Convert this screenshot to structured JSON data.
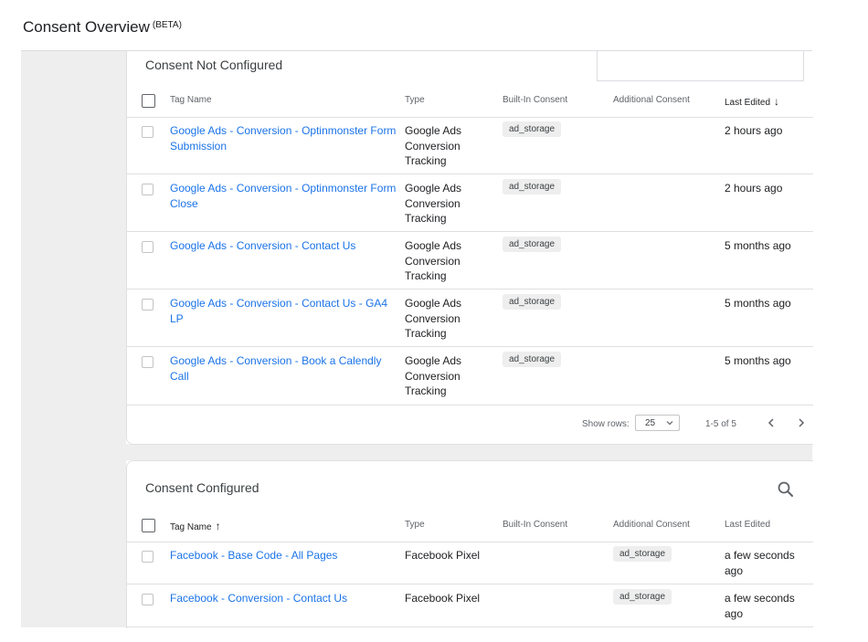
{
  "page": {
    "title": "Consent Overview",
    "title_badge": "(BETA)"
  },
  "columns": {
    "tag_name": "Tag Name",
    "type": "Type",
    "built_in": "Built-In Consent",
    "additional": "Additional Consent",
    "last_edited": "Last Edited"
  },
  "not_configured": {
    "title": "Consent Not Configured",
    "sort_column": "Last Edited",
    "sort_arrow": "↓",
    "rows": [
      {
        "name": "Google Ads - Conversion - Optinmonster Form Submission",
        "type": "Google Ads Conversion Tracking",
        "built_in": "ad_storage",
        "additional": "",
        "last_edited": "2 hours ago"
      },
      {
        "name": "Google Ads - Conversion - Optinmonster Form Close",
        "type": "Google Ads Conversion Tracking",
        "built_in": "ad_storage",
        "additional": "",
        "last_edited": "2 hours ago"
      },
      {
        "name": "Google Ads - Conversion - Contact Us",
        "type": "Google Ads Conversion Tracking",
        "built_in": "ad_storage",
        "additional": "",
        "last_edited": "5 months ago"
      },
      {
        "name": "Google Ads - Conversion - Contact Us - GA4 LP",
        "type": "Google Ads Conversion Tracking",
        "built_in": "ad_storage",
        "additional": "",
        "last_edited": "5 months ago"
      },
      {
        "name": "Google Ads - Conversion - Book a Calendly Call",
        "type": "Google Ads Conversion Tracking",
        "built_in": "ad_storage",
        "additional": "",
        "last_edited": "5 months ago"
      }
    ],
    "footer": {
      "show_rows_label": "Show rows:",
      "rows_value": "25",
      "range": "1-5 of 5"
    }
  },
  "configured": {
    "title": "Consent Configured",
    "sort_column": "Tag Name",
    "sort_arrow": "↑",
    "rows": [
      {
        "name": "Facebook - Base Code - All Pages",
        "type": "Facebook Pixel",
        "built_in": "",
        "additional": "ad_storage",
        "last_edited": "a few seconds ago"
      },
      {
        "name": "Facebook - Conversion - Contact Us",
        "type": "Facebook Pixel",
        "built_in": "",
        "additional": "ad_storage",
        "last_edited": "a few seconds ago"
      }
    ]
  },
  "icons": {
    "search": "search-icon",
    "chevron_down": "chevron-down-icon",
    "prev": "chevron-left-icon",
    "next": "chevron-right-icon"
  }
}
